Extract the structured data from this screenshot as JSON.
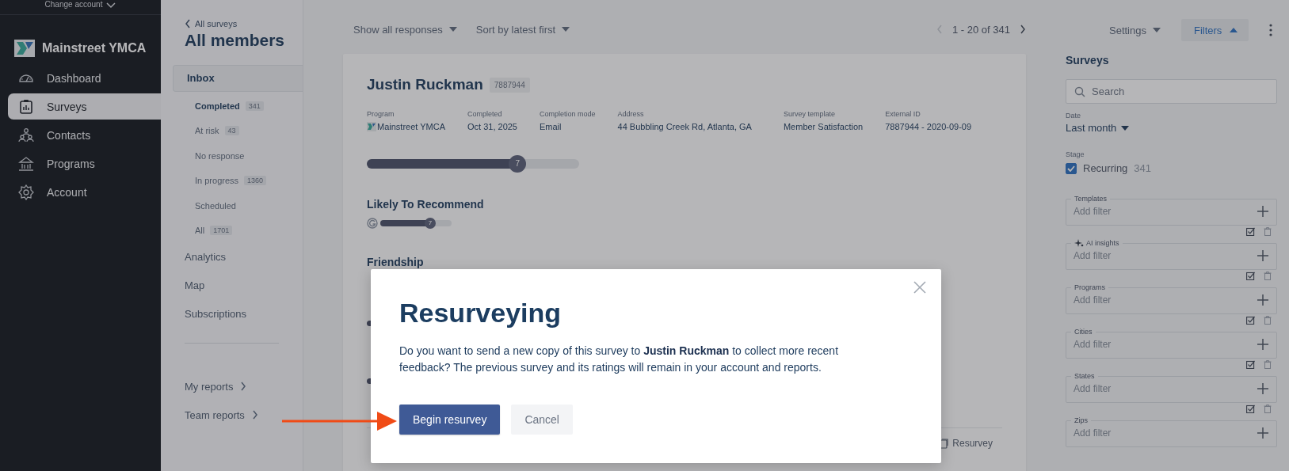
{
  "account_switcher": {
    "label": "Change account"
  },
  "brand": {
    "name": "Mainstreet YMCA"
  },
  "nav": [
    {
      "label": "Dashboard",
      "selected": false
    },
    {
      "label": "Surveys",
      "selected": true
    },
    {
      "label": "Contacts",
      "selected": false
    },
    {
      "label": "Programs",
      "selected": false
    },
    {
      "label": "Account",
      "selected": false
    }
  ],
  "breadcrumb": "All surveys",
  "page_title": "All members",
  "inbox": {
    "label": "Inbox",
    "selected": true,
    "items": [
      {
        "label": "Completed",
        "count": "341",
        "selected": true
      },
      {
        "label": "At risk",
        "count": "43",
        "selected": false
      },
      {
        "label": "No response",
        "selected": false
      },
      {
        "label": "In progress",
        "count": "1360",
        "selected": false
      },
      {
        "label": "Scheduled",
        "selected": false
      },
      {
        "label": "All",
        "count": "1701",
        "selected": false
      }
    ]
  },
  "sections": [
    {
      "label": "Analytics"
    },
    {
      "label": "Map"
    },
    {
      "label": "Subscriptions"
    }
  ],
  "reports": [
    {
      "label": "My reports"
    },
    {
      "label": "Team reports"
    }
  ],
  "toolbar": {
    "show": "Show all responses",
    "sort": "Sort by latest first",
    "pagination": "1 - 20 of 341",
    "prev_disabled": true,
    "next_disabled": false
  },
  "response": {
    "name": "Justin Ruckman",
    "id_badge": "7887944",
    "fields": [
      {
        "label": "Program",
        "value": "Mainstreet YMCA",
        "kind": "logo"
      },
      {
        "label": "Completed",
        "value": "Oct 31, 2025",
        "kind": "text"
      },
      {
        "label": "Completion mode",
        "value": "Email",
        "kind": "text"
      },
      {
        "label": "Address",
        "value": "44 Bubbling Creek Rd, Atlanta, GA",
        "kind": "text"
      },
      {
        "label": "Survey template",
        "value": "Member Satisfaction",
        "kind": "text"
      },
      {
        "label": "External ID",
        "value": "7887944 - 2020-09-09",
        "kind": "text"
      }
    ],
    "overall": {
      "level": 0.71,
      "value": "7"
    },
    "questions": [
      {
        "title": "Likely To Recommend",
        "kind": "slider",
        "level": 0.7,
        "value": "7"
      },
      {
        "title": "Friendship",
        "kind": "covered"
      },
      {
        "kind": "stub"
      },
      {
        "kind": "stub"
      }
    ],
    "footer_button": "Resurvey"
  },
  "settings": {
    "label": "Settings"
  },
  "filters_button": {
    "label": "Filters",
    "selected": true
  },
  "filter_panel": {
    "title": "Surveys",
    "search_placeholder": "Search",
    "date_label": "Date",
    "date_value": "Last month",
    "stage_label": "Stage",
    "stages": [
      {
        "label": "Recurring",
        "count": "341",
        "checked": true
      }
    ],
    "groups": [
      {
        "label": "Templates",
        "placeholder": "Add filter",
        "kind": "plain",
        "actions": true
      },
      {
        "label": "AI insights",
        "placeholder": "Add filter",
        "kind": "ai",
        "actions": true
      },
      {
        "label": "Programs",
        "placeholder": "Add filter",
        "kind": "plain",
        "actions": true
      },
      {
        "label": "Cities",
        "placeholder": "Add filter",
        "kind": "plain",
        "actions": true
      },
      {
        "label": "States",
        "placeholder": "Add filter",
        "kind": "plain",
        "actions": true
      },
      {
        "label": "Zips",
        "placeholder": "Add filter",
        "kind": "plain",
        "actions": false
      }
    ]
  },
  "dialog": {
    "title": "Resurveying",
    "body": "Do you want to send a new copy of this survey to **Justin Ruckman** to collect more recent feedback? The previous survey and its ratings will remain in your account and reports.",
    "primary": "Begin resurvey",
    "secondary": "Cancel"
  }
}
